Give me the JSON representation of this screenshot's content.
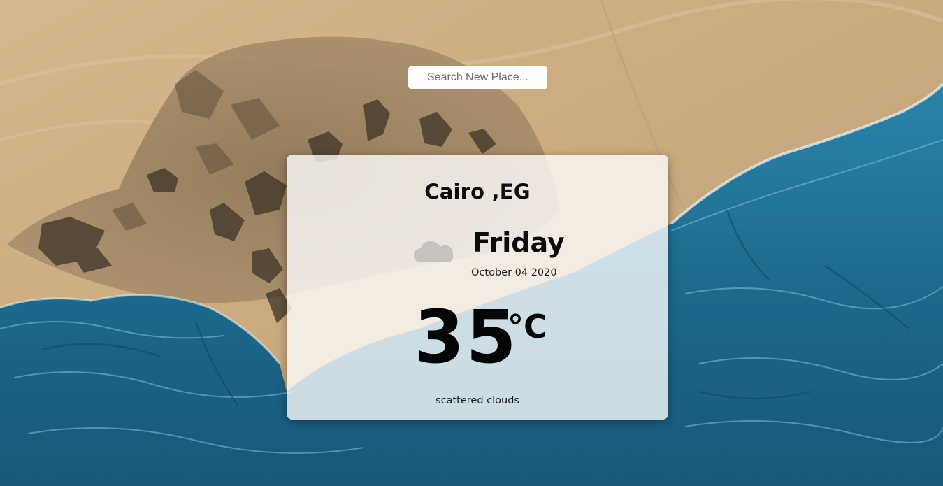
{
  "search": {
    "placeholder": "Search New Place...",
    "value": ""
  },
  "weather": {
    "location": "Cairo ,EG",
    "day": "Friday",
    "date": "October 04 2020",
    "temperature": "35",
    "unit": "°C",
    "description": "scattered clouds",
    "icon": "cloud-icon"
  },
  "colors": {
    "desert": "#c9ab82",
    "ocean": "#1f6f92",
    "card_background": "#ffffff",
    "text": "#0c0c0c"
  }
}
